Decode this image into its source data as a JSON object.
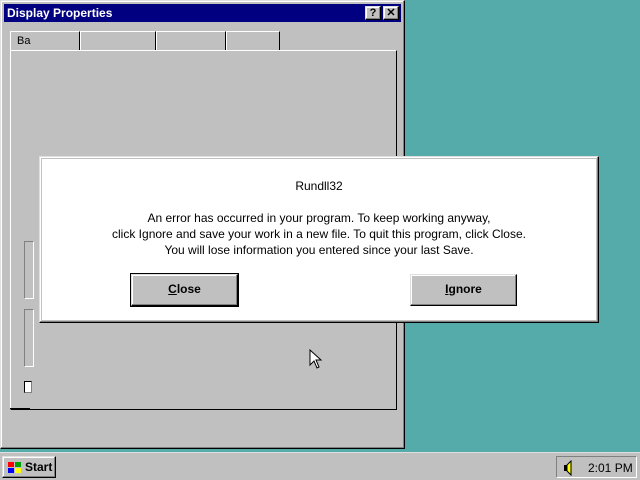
{
  "display_properties": {
    "title": "Display Properties",
    "help_glyph": "?",
    "close_glyph": "✕",
    "tab_visible_text": "Ba"
  },
  "error_dialog": {
    "title": "Rundll32",
    "message_lines": [
      "An error has occurred in your program. To keep working anyway,",
      "click Ignore and save your work in a new file. To quit this program, click Close.",
      "You will lose information you entered since your last Save."
    ],
    "close_button": {
      "accel": "C",
      "rest": "lose"
    },
    "ignore_button": {
      "accel": "I",
      "rest": "gnore"
    }
  },
  "taskbar": {
    "start_label": "Start",
    "clock": "2:01 PM",
    "speaker_icon": "speaker-icon"
  },
  "colors": {
    "desktop": "#55aaaa",
    "titlebar_active": "#000080",
    "face": "#c0c0c0"
  }
}
